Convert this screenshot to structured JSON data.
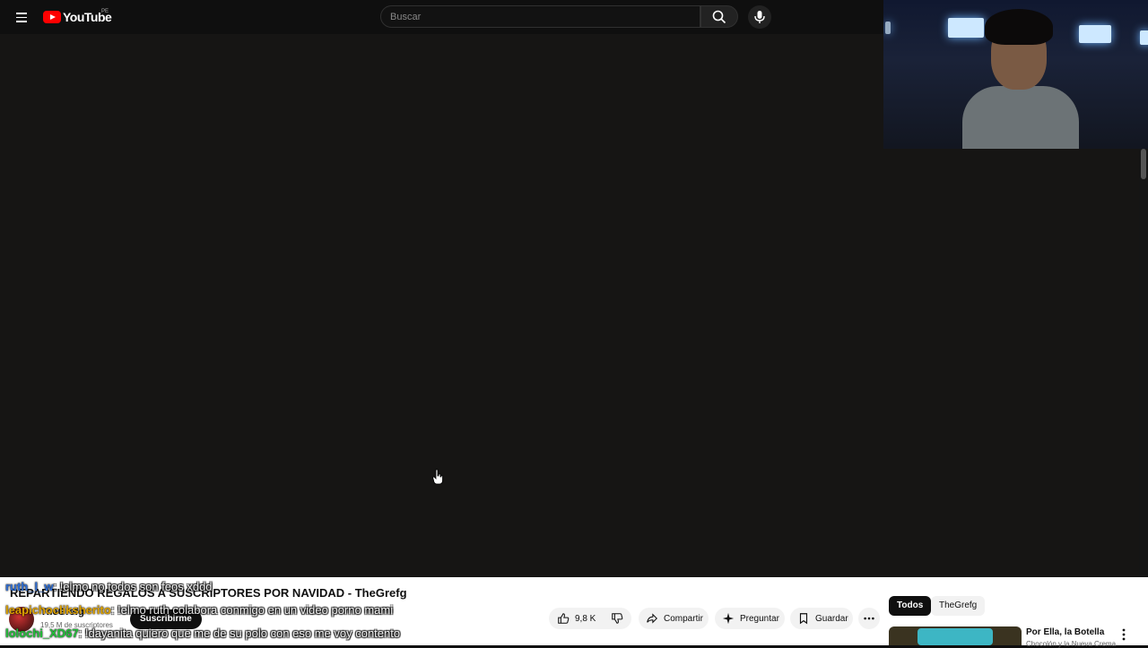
{
  "header": {
    "logo_text": "YouTube",
    "logo_country": "PE",
    "search_placeholder": "Buscar"
  },
  "video": {
    "title": "REPARTIENDO REGALOS A SUSCRIPTORES POR NAVIDAD - TheGrefg",
    "channel_name": "TheGrefg",
    "subscribers": "19,5 M de suscriptores",
    "subscribe_label": "Suscribirme",
    "like_count": "9,8 K",
    "share_label": "Compartir",
    "ask_label": "Preguntar",
    "save_label": "Guardar"
  },
  "filters": [
    {
      "label": "Todos",
      "active": true
    },
    {
      "label": "TheGrefg",
      "active": false
    }
  ],
  "recommended": {
    "title": "Por Ella, la Botella",
    "subtitle": "Chocolón y la Nueva Crema"
  },
  "chat": [
    {
      "user": "ruth_l_w",
      "message": ": !elmo no todos son feos xddd",
      "user_color": "#2f6fd6"
    },
    {
      "user": "leapichocliksherito",
      "message": ": !elmo ruth colabora conmigo en un video porno mami",
      "user_color": "#e0a400"
    },
    {
      "user": "lolochi_XD67",
      "message": ": !dayanita quiero que me de su polo con eso me voy contento",
      "user_color": "#22c23a"
    }
  ],
  "colors": {
    "brand_red": "#ff0000",
    "player_bg": "#161514"
  }
}
